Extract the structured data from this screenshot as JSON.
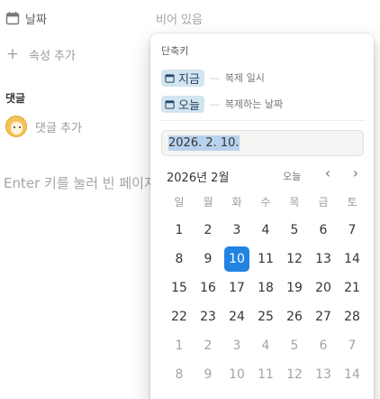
{
  "properties": {
    "date_label": "날짜",
    "date_value_placeholder": "비어 있음",
    "add_property_label": "속성 추가"
  },
  "comments": {
    "title": "댓글",
    "add_comment_label": "댓글 추가"
  },
  "page_body_placeholder": "Enter 키를 눌러 빈 페이지",
  "date_popup": {
    "shortcuts_title": "단축키",
    "shortcuts": [
      {
        "chip": "지금",
        "description": "복제 일시"
      },
      {
        "chip": "오늘",
        "description": "복제하는 날짜"
      }
    ],
    "date_input_value": "2026. 2. 10.",
    "month_label": "2026년 2월",
    "today_button": "오늘",
    "prev_icon": "chevron-left-icon",
    "next_icon": "chevron-right-icon",
    "weekdays": [
      "일",
      "월",
      "화",
      "수",
      "목",
      "금",
      "토"
    ],
    "weeks": [
      [
        "1",
        "2",
        "3",
        "4",
        "5",
        "6",
        "7"
      ],
      [
        "8",
        "9",
        "10",
        "11",
        "12",
        "13",
        "14"
      ],
      [
        "15",
        "16",
        "17",
        "18",
        "19",
        "20",
        "21"
      ],
      [
        "22",
        "23",
        "24",
        "25",
        "26",
        "27",
        "28"
      ],
      [
        "1",
        "2",
        "3",
        "4",
        "5",
        "6",
        "7"
      ],
      [
        "8",
        "9",
        "10",
        "11",
        "12",
        "13",
        "14"
      ]
    ],
    "selected_day": "10",
    "accent_color": "#2383e2",
    "chip_color": "#d3e5ef"
  }
}
